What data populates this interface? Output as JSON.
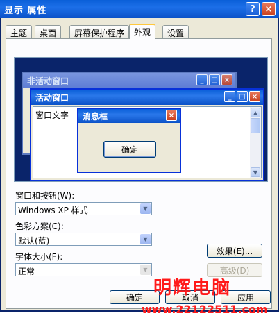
{
  "window": {
    "title": "显示 属性",
    "help_label": "?",
    "close_label": "×"
  },
  "tabs": [
    {
      "label": "主题"
    },
    {
      "label": "桌面"
    },
    {
      "label": "屏幕保护程序"
    },
    {
      "label": "外观"
    },
    {
      "label": "设置"
    }
  ],
  "active_tab": "外观",
  "preview": {
    "inactive_title": "非活动窗口",
    "active_title": "活动窗口",
    "window_text": "窗口文字",
    "msgbox_title": "消息框",
    "msgbox_ok": "确定",
    "min_glyph": "_",
    "max_glyph": "□",
    "close_glyph": "×",
    "scroll_up": "▲",
    "scroll_down": "▼"
  },
  "fields": {
    "windows_buttons": {
      "label": "窗口和按钮(W):",
      "value": "Windows XP 样式"
    },
    "color_scheme": {
      "label": "色彩方案(C):",
      "value": "默认(蓝)"
    },
    "font_size": {
      "label": "字体大小(F):",
      "value": "正常"
    }
  },
  "combo_arrow": "▼",
  "buttons": {
    "effects": "效果(E)...",
    "advanced": "高级(D)",
    "ok": "确定",
    "cancel": "取消",
    "apply": "应用"
  },
  "watermark": {
    "name": "明辉电脑",
    "url": "www.22122511.com"
  },
  "colors": {
    "titlebar_blue": "#0a5fd8",
    "dialog_bg": "#ece9d8",
    "preview_bg": "#0a246a",
    "watermark_red": "#ff1a1a"
  }
}
